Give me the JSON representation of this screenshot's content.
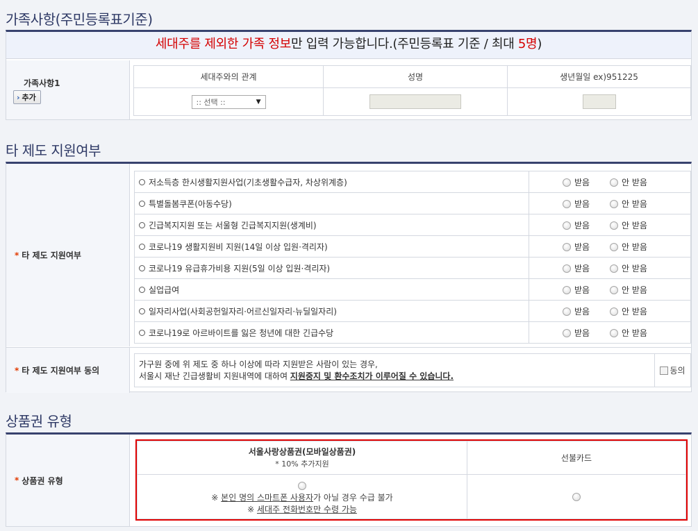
{
  "family": {
    "heading": "가족사항(주민등록표기준)",
    "notice_red1": "세대주를 제외한 가족 정보",
    "notice_mid": "만 입력 가능합니다.(주민등록표 기준 / 최대 ",
    "notice_red2": "5명",
    "notice_end": ")",
    "row_label": "가족사항1",
    "add_button": "추가",
    "col_relation": "세대주와의 관계",
    "col_name": "성명",
    "col_birth": "생년월일 ex)951225",
    "select_value": ":: 선택 ::"
  },
  "support": {
    "heading": "타 제도 지원여부",
    "row_label": "타 제도 지원여부",
    "options": {
      "received": "받음",
      "not_received": "안 받음"
    },
    "items": [
      "저소득층 한시생활지원사업(기초생활수급자, 차상위계층)",
      "특별돌봄쿠폰(아동수당)",
      "긴급복지지원 또는 서울형 긴급복지지원(생계비)",
      "코로나19 생활지원비 지원(14일 이상 입원·격리자)",
      "코로나19 유급휴가비용 지원(5일 이상 입원·격리자)",
      "실업급여",
      "일자리사업(사회공헌일자리·어르신일자리·뉴딜일자리)",
      "코로나19로 아르바이트를 잃은 청년에 대한 긴급수당"
    ],
    "consent_label": "타 제도 지원여부 동의",
    "consent_line1": "가구원 중에 위 제도 중 하나 이상에 따라 지원받은 사람이 있는 경우,",
    "consent_line2a": "서울시 재난 긴급생활비 지원내역에 대하여 ",
    "consent_line2b": "지원중지 및 환수조치가 이루어질 수 있습니다.",
    "consent_checkbox": "동의"
  },
  "voucher": {
    "heading": "상품권 유형",
    "row_label": "상품권 유형",
    "col1_title": "서울사랑상품권(모바일상품권)",
    "col1_sub": "* 10% 추가지원",
    "col2_title": "선불카드",
    "note1_prefix": "※ ",
    "note1_u": "본인 명의 스마트폰 사용자",
    "note1_end": "가 아닐 경우 수급 불가",
    "note2_prefix": "※ ",
    "note2_u": "세대주 전화번호만 수령 가능"
  },
  "colors": {
    "heading": "#2f3a66",
    "accent_red": "#d40000",
    "highlight_border": "#e00000"
  }
}
